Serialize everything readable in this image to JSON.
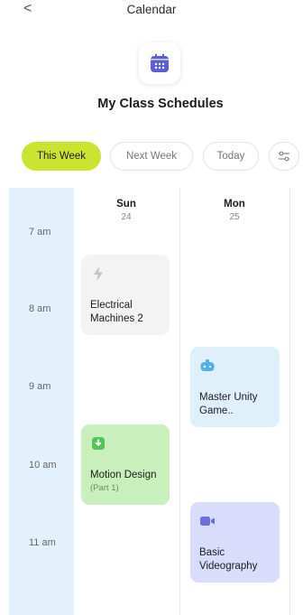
{
  "header": {
    "back_label": "<",
    "title": "Calendar",
    "page_title": "My Class Schedules"
  },
  "filters": [
    {
      "label": "This Week",
      "active": true
    },
    {
      "label": "Next Week",
      "active": false
    },
    {
      "label": "Today",
      "active": false
    }
  ],
  "time_slots": [
    "7 am",
    "8 am",
    "9 am",
    "10 am",
    "11 am"
  ],
  "days": [
    {
      "name": "Sun",
      "date": "24"
    },
    {
      "name": "Mon",
      "date": "25"
    }
  ],
  "events": [
    {
      "title": "Electrical Machines 2",
      "subtitle": "",
      "icon": "lightning-icon",
      "color": "#f3f3f3"
    },
    {
      "title": "Motion Design",
      "subtitle": "(Part 1)",
      "icon": "download-icon",
      "color": "#c9efbd"
    },
    {
      "title": "Master Unity Game..",
      "subtitle": "",
      "icon": "gamepad-icon",
      "color": "#dff0fb"
    },
    {
      "title": "Basic Videography",
      "subtitle": "",
      "icon": "video-camera-icon",
      "color": "#d9dcfb"
    }
  ],
  "colors": {
    "accent": "#cbe430",
    "brand": "#5b5fd6",
    "time_column": "#e2f1fb"
  }
}
